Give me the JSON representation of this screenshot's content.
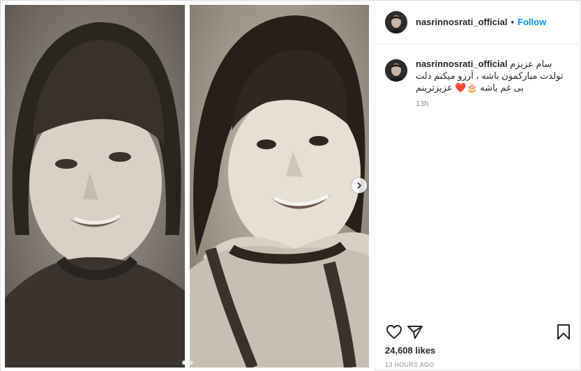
{
  "header": {
    "username": "nasrinnosrati_official",
    "separator": "•",
    "follow_label": "Follow"
  },
  "caption": {
    "username": "nasrinnosrati_official",
    "text": "سام عزیزم تولدت مبارکمون باشه ، آرزو میکنم دلت بی غم باشه 🎂❤️ عزیزترینم",
    "time": "13h"
  },
  "media": {
    "carousel_total": 2,
    "carousel_active": 0
  },
  "actions": {
    "like_icon": "heart-outline-icon",
    "share_icon": "paper-plane-icon",
    "save_icon": "bookmark-outline-icon"
  },
  "stats": {
    "likes": "24,608 likes",
    "timestamp": "13 HOURS AGO"
  }
}
